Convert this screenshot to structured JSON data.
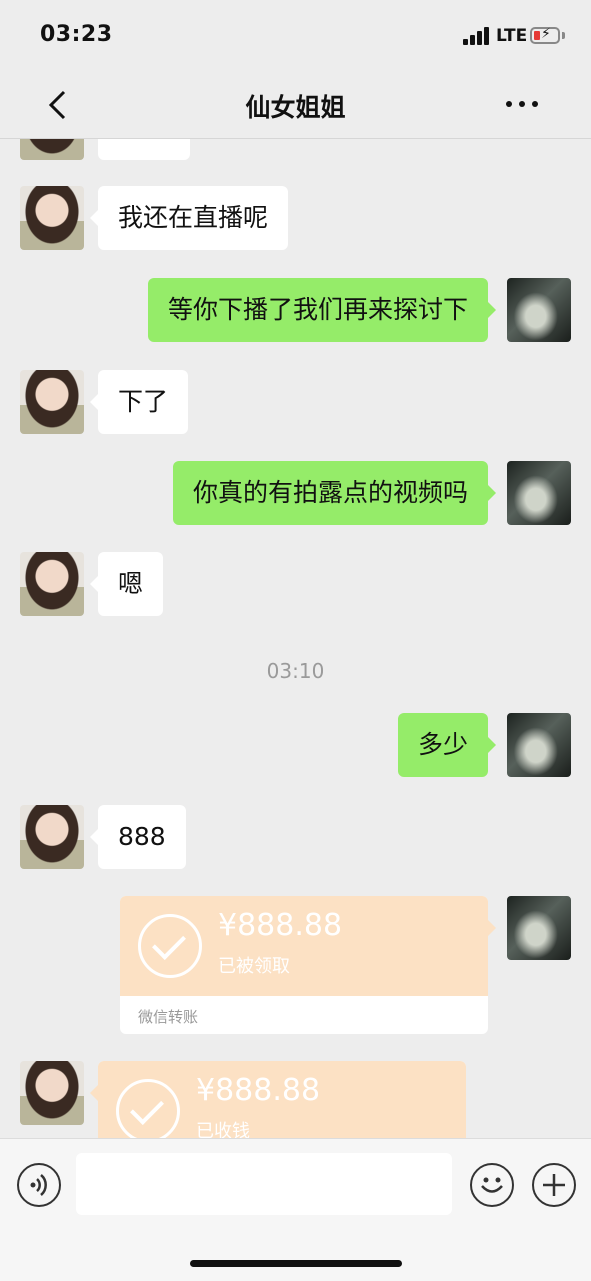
{
  "status_bar": {
    "time": "03:23",
    "network": "LTE"
  },
  "header": {
    "title": "仙女姐姐"
  },
  "messages": [
    {
      "side": "left",
      "text": "我还在直播呢"
    },
    {
      "side": "right",
      "text": "等你下播了我们再来探讨下"
    },
    {
      "side": "left",
      "text": "下了"
    },
    {
      "side": "right",
      "text": "你真的有拍露点的视频吗"
    },
    {
      "side": "left",
      "text": "嗯"
    },
    {
      "side": "right",
      "text": "多少"
    },
    {
      "side": "left",
      "text": "888"
    }
  ],
  "time_divider": "03:10",
  "transfers": [
    {
      "side": "right",
      "amount": "¥888.88",
      "status": "已被领取",
      "footer": "微信转账"
    },
    {
      "side": "left",
      "amount": "¥888.88",
      "status": "已收钱"
    }
  ],
  "input": {
    "value": ""
  }
}
